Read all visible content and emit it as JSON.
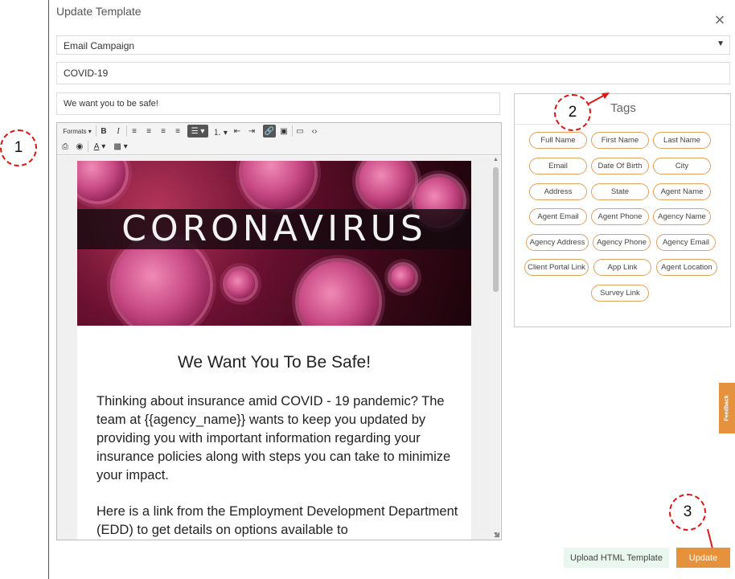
{
  "modal": {
    "title": "Update Template",
    "close_glyph": "×"
  },
  "form": {
    "template_type": "Email Campaign",
    "template_name": "COVID-19",
    "subject": "We want you to be safe!"
  },
  "toolbar": {
    "formats_label": "Formats",
    "bold": "B",
    "italic": "I",
    "text_color": "A",
    "icons": [
      "align-left-icon",
      "align-center-icon",
      "align-right-icon",
      "align-justify-icon",
      "bullet-list-icon",
      "numbered-list-icon",
      "outdent-icon",
      "indent-icon",
      "link-icon",
      "image-icon",
      "media-icon",
      "source-code-icon",
      "print-icon",
      "preview-icon",
      "text-color-icon",
      "background-color-icon"
    ]
  },
  "email": {
    "banner_text": "CORONAVIRUS",
    "heading": "We Want You To Be Safe!",
    "paragraph1": "Thinking about insurance amid COVID - 19 pandemic? The team at {{agency_name}} wants to keep you updated by providing you with important information regarding your insurance policies along with steps you can take to minimize your impact.",
    "paragraph2": "Here is a link from the Employment Development Department (EDD) to get details on options available to"
  },
  "tags_panel": {
    "title": "Tags",
    "tags": [
      "Full Name",
      "First Name",
      "Last Name",
      "Email",
      "Date Of Birth",
      "City",
      "Address",
      "State",
      "Agent Name",
      "Agent Email",
      "Agent Phone",
      "Agency Name",
      "Agency Address",
      "Agency Phone",
      "Agency Email",
      "Client Portal Link",
      "App Link",
      "Agent Location",
      "Survey Link"
    ]
  },
  "annotations": [
    "1",
    "2",
    "3"
  ],
  "buttons": {
    "upload": "Upload HTML Template",
    "update": "Update"
  },
  "feedback_label": "Feedback",
  "colors": {
    "accent": "#e4923e",
    "tag_border": "#e0a060",
    "annotation": "#d61a1a",
    "upload_bg": "#eaf7ee"
  }
}
